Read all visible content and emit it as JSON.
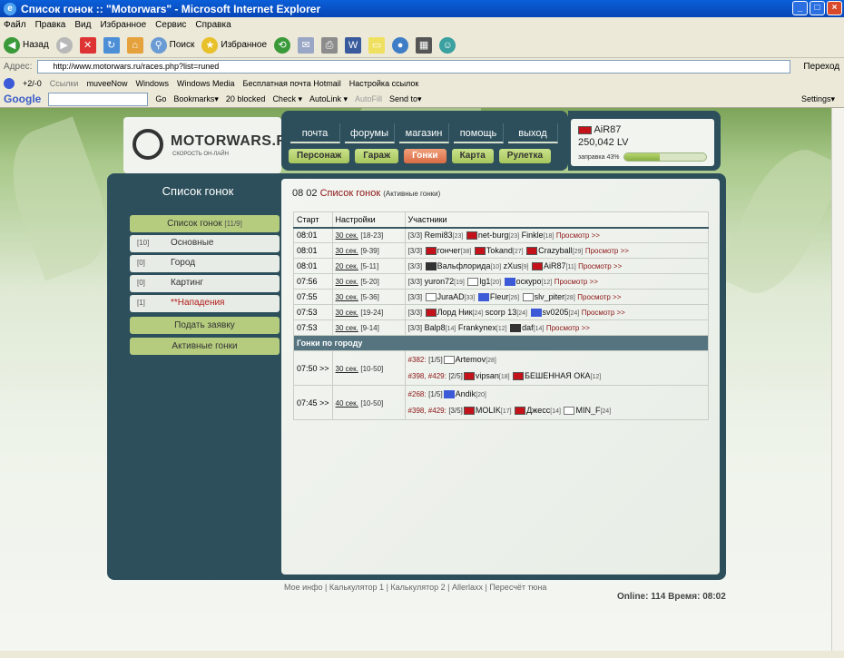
{
  "window": {
    "title": "Список гонок :: \"Motorwars\" - Microsoft Internet Explorer"
  },
  "menu": [
    "Файл",
    "Правка",
    "Вид",
    "Избранное",
    "Сервис",
    "Справка"
  ],
  "toolbar": {
    "back": "Назад",
    "search": "Поиск",
    "favorites": "Избранное"
  },
  "address": {
    "label": "Адрес:",
    "url": "http://www.motorwars.ru/races.php?list=runed",
    "go": "Переход"
  },
  "links": {
    "counter": "+2/-0",
    "label": "Ссылки",
    "items": [
      "muveeNow",
      "Windows",
      "Windows Media",
      "Бесплатная почта Hotmail",
      "Настройка ссылок"
    ]
  },
  "google": {
    "logo": "Google",
    "go": "Go",
    "bookmarks": "Bookmarks▾",
    "blocked": "20 blocked",
    "check": "Check ▾",
    "autolink": "AutoLink ▾",
    "autofill": "AutoFill",
    "sendto": "Send to▾",
    "settings": "Settings▾"
  },
  "site": {
    "logo": "MOTORWARS.RU",
    "logo_sub": "СКОРОСТЬ ОН-ЛАЙН",
    "nav_top": [
      "почта",
      "форумы",
      "магазин",
      "помощь",
      "выход"
    ],
    "nav_bottom": [
      "Персонаж",
      "Гараж",
      "Гонки",
      "Карта",
      "Рулетка"
    ],
    "nav_active": "Гонки",
    "user": {
      "name": "AiR87",
      "money": "250,042 LV",
      "fuel_label": "заправка 43%",
      "fuel_percent": 43
    }
  },
  "sidebar": {
    "title": "Список гонок",
    "header_item": {
      "label": "Список гонок",
      "count": "[11/9]"
    },
    "items": [
      {
        "count": "[10]",
        "label": "Основные"
      },
      {
        "count": "[0]",
        "label": "Город"
      },
      {
        "count": "[0]",
        "label": "Картинг"
      },
      {
        "count": "[1]",
        "label": "**Нападения"
      }
    ],
    "apply": "Подать заявку",
    "active": "Активные гонки"
  },
  "content": {
    "time": "08 02",
    "title": "Список гонок",
    "subtitle": "(Активные гонки)",
    "headers": [
      "Старт",
      "Настройки",
      "Участники"
    ],
    "rows": [
      {
        "start": "08:01",
        "sec": "30 сек.",
        "range": "[18-23]",
        "slot": "[3/3]",
        "participants": [
          {
            "name": "Remi83",
            "lvl": "[23]"
          },
          {
            "icon": "red",
            "name": "net-burg",
            "lvl": "[23]"
          },
          {
            "name": "Finkle",
            "lvl": "[18]"
          }
        ],
        "view": "Просмотр >>"
      },
      {
        "start": "08:01",
        "sec": "30 сек.",
        "range": "[9-39]",
        "slot": "[3/3]",
        "participants": [
          {
            "icon": "red",
            "name": "гончег",
            "lvl": "[38]"
          },
          {
            "icon": "red",
            "name": "Tokand",
            "lvl": "[27]"
          },
          {
            "icon": "red",
            "name": "Crazyball",
            "lvl": "[29]"
          }
        ],
        "view": "Просмотр >>"
      },
      {
        "start": "08:01",
        "sec": "20 сек.",
        "range": "[5-11]",
        "slot": "[3/3]",
        "participants": [
          {
            "icon": "black",
            "name": "Вальфлорида",
            "lvl": "[10]"
          },
          {
            "name": "zXus",
            "lvl": "[9]"
          },
          {
            "icon": "red",
            "name": "AiR87",
            "lvl": "[11]"
          }
        ],
        "view": "Просмотр >>"
      },
      {
        "start": "07:56",
        "sec": "30 сек.",
        "range": "[5-20]",
        "slot": "[3/3]",
        "participants": [
          {
            "name": "yuron72",
            "lvl": "[19]"
          },
          {
            "icon": "gray",
            "name": "lg1",
            "lvl": "[20]"
          },
          {
            "icon": "blue",
            "name": "оскуро",
            "lvl": "[12]"
          }
        ],
        "view": "Просмотр >>"
      },
      {
        "start": "07:55",
        "sec": "30 сек.",
        "range": "[5-36]",
        "slot": "[3/3]",
        "participants": [
          {
            "icon": "gray",
            "name": "JuraAD",
            "lvl": "[33]"
          },
          {
            "icon": "blue",
            "name": "Fleur",
            "lvl": "[26]"
          },
          {
            "icon": "gray",
            "name": "slv_piter",
            "lvl": "[28]"
          }
        ],
        "view": "Просмотр >>"
      },
      {
        "start": "07:53",
        "sec": "30 сек.",
        "range": "[19-24]",
        "slot": "[3/3]",
        "participants": [
          {
            "icon": "red",
            "name": "Лорд Ник",
            "lvl": "[24]"
          },
          {
            "name": "scorp 13",
            "lvl": "[24]"
          },
          {
            "icon": "blue",
            "name": "sv0205",
            "lvl": "[24]"
          }
        ],
        "view": "Просмотр >>"
      },
      {
        "start": "07:53",
        "sec": "30 сек.",
        "range": "[9-14]",
        "slot": "[3/3]",
        "participants": [
          {
            "name": "Balp8",
            "lvl": "[14]"
          },
          {
            "name": "Frankynex",
            "lvl": "[12]"
          },
          {
            "icon": "black",
            "name": "daf",
            "lvl": "[14]"
          }
        ],
        "view": "Просмотр >>"
      }
    ],
    "city_header": "Гонки по городу",
    "city_races": [
      {
        "start": "07:50 >>",
        "sec": "30 сек.",
        "range": "[10-50]",
        "lines": [
          {
            "num": "#382:",
            "slot": "[1/5]",
            "participants": [
              {
                "icon": "gray",
                "name": "Artemov",
                "lvl": "[28]"
              }
            ]
          },
          {
            "num": "#398, #429:",
            "slot": "[2/5]",
            "participants": [
              {
                "icon": "red",
                "name": "vipsan",
                "lvl": "[18]"
              },
              {
                "icon": "red",
                "name": "БЕШЕННАЯ ОКА",
                "lvl": "[12]"
              }
            ]
          }
        ]
      },
      {
        "start": "07:45 >>",
        "sec": "40 сек.",
        "range": "[10-50]",
        "lines": [
          {
            "num": "#268:",
            "slot": "[1/5]",
            "participants": [
              {
                "icon": "blue",
                "name": "Andik",
                "lvl": "[20]"
              }
            ]
          },
          {
            "num": "#398, #429:",
            "slot": "[3/5]",
            "participants": [
              {
                "icon": "red",
                "name": "MOLIK",
                "lvl": "[17]"
              },
              {
                "icon": "red",
                "name": "Джесс",
                "lvl": "[14]"
              },
              {
                "icon": "gray",
                "name": "MIN_F",
                "lvl": "[24]"
              }
            ]
          }
        ]
      }
    ]
  },
  "footer": {
    "links": [
      "Мое инфо",
      "Калькулятор 1",
      "Калькулятор 2",
      "Allerlaxx",
      "Пересчёт тюна"
    ],
    "online": "Online: 114  Время: 08:02"
  }
}
